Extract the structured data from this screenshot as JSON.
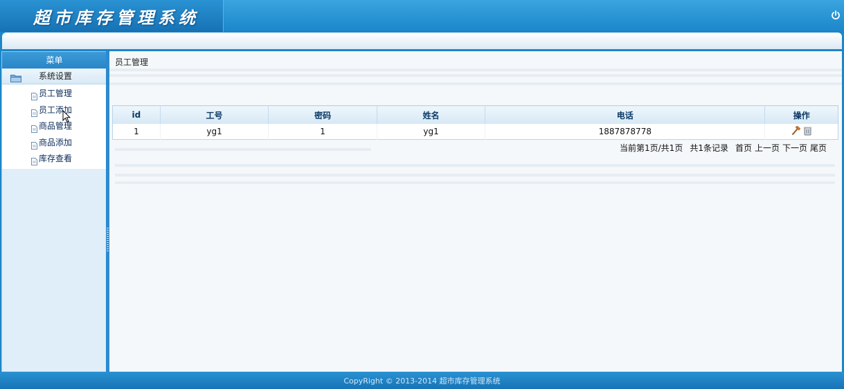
{
  "header": {
    "app_title": "超市库存管理系统"
  },
  "sidebar": {
    "menu_title": "菜单",
    "group_label": "系统设置",
    "items": [
      {
        "label": "员工管理"
      },
      {
        "label": "员工添加"
      },
      {
        "label": "商品管理"
      },
      {
        "label": "商品添加"
      },
      {
        "label": "库存查看"
      }
    ]
  },
  "content": {
    "title": "员工管理",
    "table": {
      "headers": [
        "id",
        "工号",
        "密码",
        "姓名",
        "电话",
        "操作"
      ],
      "rows": [
        {
          "id": "1",
          "code": "yg1",
          "password": "1",
          "name": "yg1",
          "phone": "1887878778"
        }
      ]
    },
    "pagination": {
      "summary": "当前第1页/共1页",
      "total": "共1条记录",
      "first": "首页",
      "prev": "上一页",
      "next": "下一页",
      "last": "尾页"
    }
  },
  "footer": {
    "copyright": "CopyRight © 2013-2014 超市库存管理系统"
  },
  "colors": {
    "primary": "#1c86c8",
    "sidebar_bg": "#dfeef8",
    "content_bg": "#f5f8fa"
  },
  "icons": [
    "power-icon",
    "folder-icon",
    "document-icon",
    "edit-hammer-icon",
    "trash-icon",
    "mouse-cursor-icon"
  ]
}
